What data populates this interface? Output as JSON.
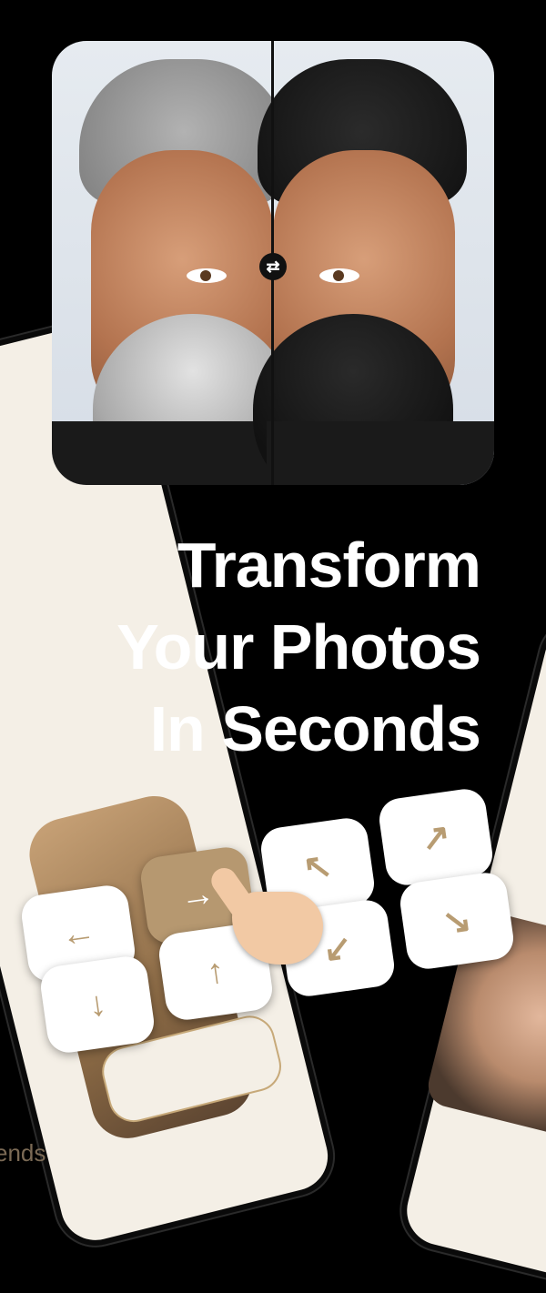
{
  "headline": {
    "line1": "Transform",
    "line2": "Your Photos",
    "line3": "In Seconds"
  },
  "hero": {
    "swap_icon": "⇄"
  },
  "keys": [
    {
      "icon": "arrow-left-icon",
      "glyph": "←"
    },
    {
      "icon": "arrow-down-icon",
      "glyph": "↓"
    },
    {
      "icon": "arrow-right-icon",
      "glyph": "→"
    },
    {
      "icon": "arrow-up-icon",
      "glyph": "↑"
    },
    {
      "icon": "arrow-up-left-icon",
      "glyph": "↖"
    },
    {
      "icon": "arrow-down-left-icon",
      "glyph": "↙"
    },
    {
      "icon": "arrow-up-right-icon",
      "glyph": "↗"
    },
    {
      "icon": "arrow-down-right-icon",
      "glyph": "↘"
    }
  ],
  "bottom_left_pill": {
    "text": "ends"
  },
  "colors": {
    "accent": "#b69870",
    "background": "#000000",
    "key_background": "#ffffff"
  }
}
